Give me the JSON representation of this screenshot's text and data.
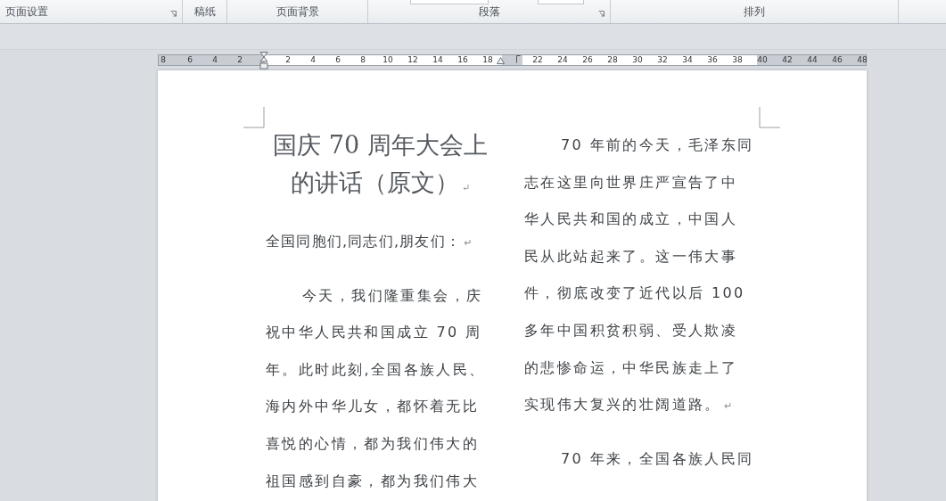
{
  "ribbon": {
    "groups": [
      {
        "label": "页面设置",
        "launcher": true,
        "inputs": false
      },
      {
        "label": "稿纸",
        "launcher": false,
        "inputs": false
      },
      {
        "label": "页面背景",
        "launcher": false,
        "inputs": false
      },
      {
        "label": "段落",
        "launcher": true,
        "inputs": true
      },
      {
        "label": "排列",
        "launcher": false,
        "inputs": false
      }
    ]
  },
  "ruler": {
    "labels": [
      "8",
      "6",
      "4",
      "2",
      "2",
      "4",
      "6",
      "8",
      "10",
      "12",
      "14",
      "16",
      "18",
      "22",
      "24",
      "26",
      "28",
      "30",
      "32",
      "34",
      "36",
      "38",
      "40",
      "42",
      "44",
      "46",
      "48"
    ]
  },
  "document": {
    "columns": [
      {
        "blocks": [
          {
            "kind": "title",
            "indent": false,
            "lines": [
              "国庆 70 周年大会上",
              "的讲话（原文）"
            ],
            "end_mark": "↵"
          },
          {
            "kind": "greeting",
            "indent": false,
            "lines": [
              "全国同胞们,同志们,朋友们："
            ],
            "end_mark": "↵"
          },
          {
            "kind": "paragraph",
            "indent": true,
            "lines": [
              "今天，我们隆重集会，庆",
              "祝中华人民共和国成立 70 周",
              "年。此时此刻,全国各族人民、",
              "海内外中华儿女，都怀着无比",
              "喜悦的心情，都为我们伟大的",
              "祖国感到自豪，都为我们伟大"
            ]
          }
        ]
      },
      {
        "blocks": [
          {
            "kind": "paragraph",
            "indent": true,
            "lines": [
              "70 年前的今天，毛泽东同",
              "志在这里向世界庄严宣告了中",
              "华人民共和国的成立，中国人",
              "民从此站起来了。这一伟大事",
              "件，彻底改变了近代以后 100",
              "多年中国积贫积弱、受人欺凌",
              "的悲惨命运，中华民族走上了",
              "实现伟大复兴的壮阔道路。"
            ],
            "end_mark": "↵"
          },
          {
            "kind": "paragraph",
            "indent": true,
            "lines": [
              "70 年来，全国各族人民同"
            ]
          }
        ]
      }
    ]
  }
}
